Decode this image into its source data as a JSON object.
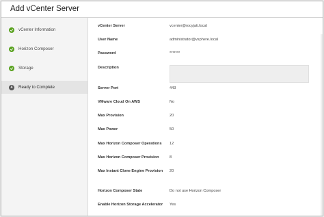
{
  "window": {
    "title": "Add vCenter Server"
  },
  "steps": [
    {
      "label": "vCenter Information",
      "state": "done"
    },
    {
      "label": "Horizon Composer",
      "state": "done"
    },
    {
      "label": "Storage",
      "state": "done"
    },
    {
      "label": "Ready to Complete",
      "state": "active",
      "number": "4"
    }
  ],
  "summary": {
    "vcenter_server": {
      "label": "vCenter Server",
      "value": "vcenter@rocyjati.local"
    },
    "user_name": {
      "label": "User Name",
      "value": "administrator@vsphere.local"
    },
    "password": {
      "label": "Password",
      "value": "*******"
    },
    "description": {
      "label": "Description",
      "value": ""
    },
    "server_port": {
      "label": "Server Port",
      "value": "443"
    },
    "vmware_cloud_on_aws": {
      "label": "VMware Cloud On AWS",
      "value": "No"
    },
    "max_provision": {
      "label": "Max Provision",
      "value": "20"
    },
    "max_power": {
      "label": "Max Power",
      "value": "50"
    },
    "max_composer_operations": {
      "label": "Max Horizon Composer Operations",
      "value": "12"
    },
    "max_composer_provision": {
      "label": "Max Horizon Composer Provision",
      "value": "8"
    },
    "max_instant_clone": {
      "label": "Max Instant Clone Engine Provision",
      "value": "20"
    },
    "composer_state": {
      "label": "Horizon Composer State",
      "value": "Do not use Horizon Composer"
    },
    "storage_accelerator": {
      "label": "Enable Horizon Storage Accelerator",
      "value": "Yes"
    }
  },
  "colors": {
    "done": "#5aa220",
    "active_badge": "#565656"
  },
  "icons": {
    "done": "check-icon"
  }
}
